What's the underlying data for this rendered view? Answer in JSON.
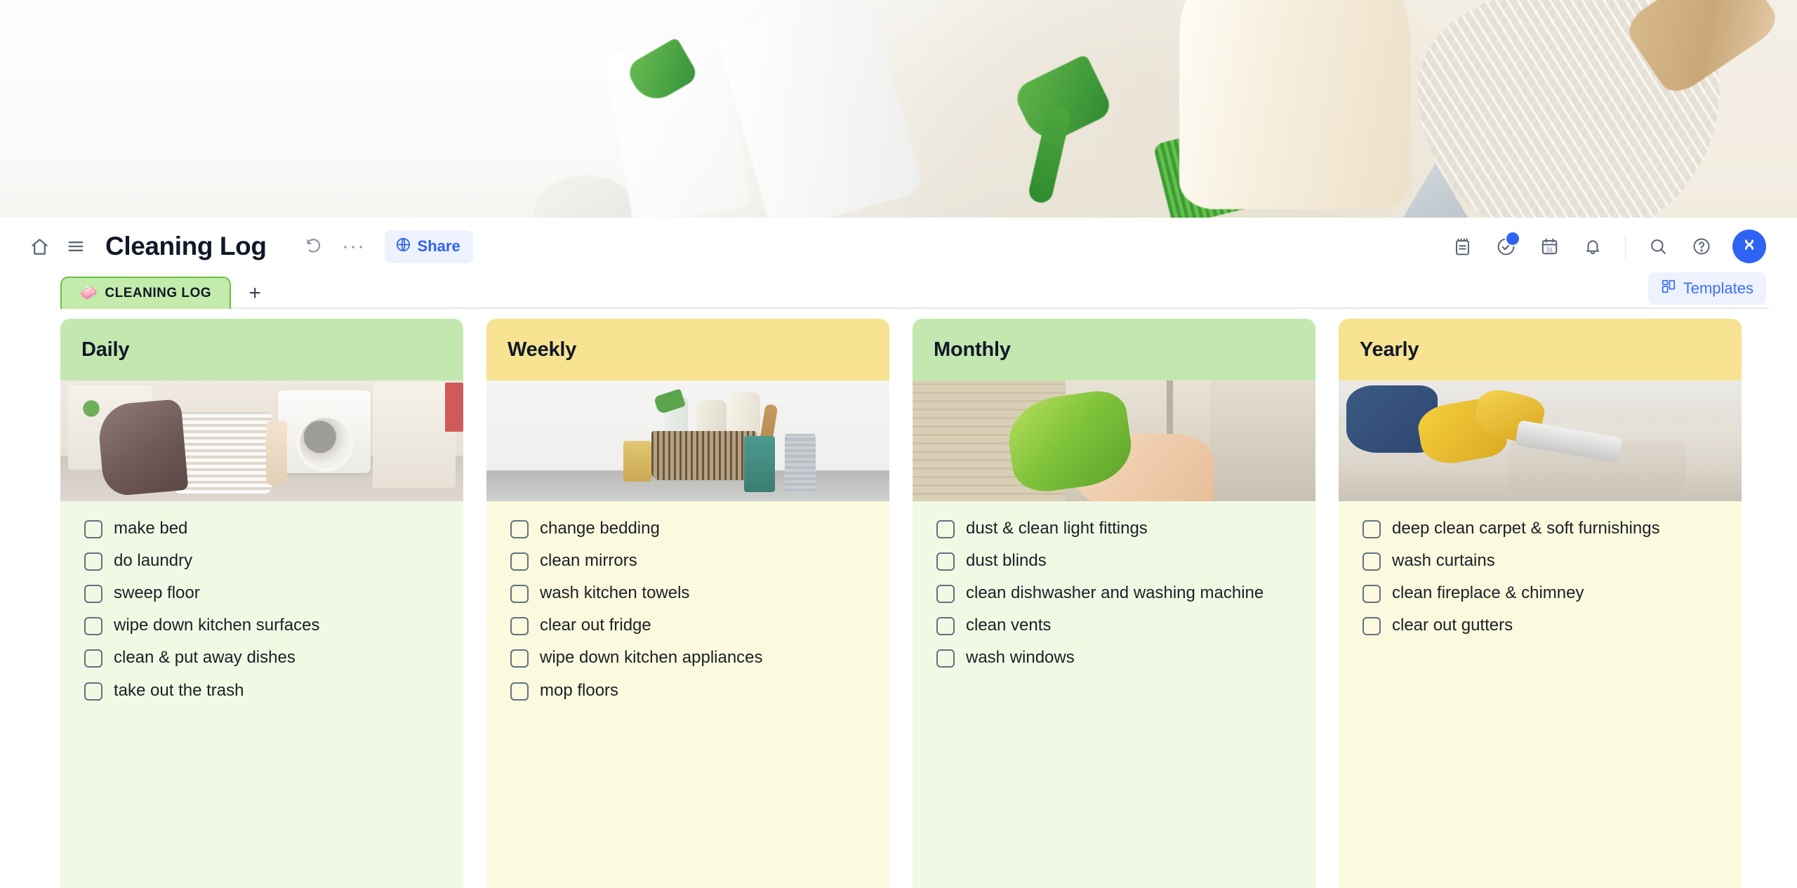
{
  "banner": {
    "alt": "cleaning supplies flat lay photo"
  },
  "toolbar": {
    "home_icon": "home-icon",
    "menu_icon": "hamburger-menu-icon",
    "title": "Cleaning Log",
    "undo_icon": "undo-icon",
    "more_label": "···",
    "share_label": "Share",
    "share_icon": "globe-icon",
    "right_icons": [
      {
        "name": "notepad-icon",
        "badge": false
      },
      {
        "name": "task-check-icon",
        "badge": true
      },
      {
        "name": "calendar-icon",
        "badge": false,
        "day": "31"
      },
      {
        "name": "bell-icon",
        "badge": false
      },
      {
        "name": "search-icon",
        "badge": false
      },
      {
        "name": "help-icon",
        "badge": false
      }
    ],
    "avatar_icon": "user-avatar",
    "accent_color": "#2f63f5",
    "share_bg": "#eef2fe"
  },
  "tabs": {
    "active": {
      "emoji": "🧼",
      "label": "CLEANING LOG"
    },
    "add_label": "+",
    "templates_label": "Templates",
    "templates_icon": "grid-icon"
  },
  "board": {
    "columns": [
      {
        "title": "Daily",
        "theme": "green",
        "photo": "laundry-room-basket-photo",
        "items": [
          "make bed",
          "do laundry",
          "sweep floor",
          "wipe down kitchen surfaces",
          "clean & put away dishes",
          "take out the trash"
        ]
      },
      {
        "title": "Weekly",
        "theme": "yellow",
        "photo": "cleaning-supplies-counter-photo",
        "items": [
          "change bedding",
          "clean mirrors",
          "wash kitchen towels",
          "clear out fridge",
          "wipe down kitchen appliances",
          "mop floors"
        ]
      },
      {
        "title": "Monthly",
        "theme": "green",
        "photo": "hand-wiping-window-photo",
        "items": [
          "dust & clean light fittings",
          "dust blinds",
          "clean dishwasher and washing machine",
          "clean vents",
          "wash windows"
        ]
      },
      {
        "title": "Yearly",
        "theme": "yellow",
        "photo": "vacuuming-sofa-photo",
        "items": [
          "deep clean carpet & soft furnishings",
          "wash curtains",
          "clean fireplace & chimney",
          "clear out gutters"
        ]
      }
    ]
  },
  "colors": {
    "green_header": "#c3e8af",
    "green_body": "#f1f8e4",
    "yellow_header": "#f7e391",
    "yellow_body": "#fbfade",
    "tab_green": "#c3ebab",
    "tab_border": "#69c043"
  }
}
